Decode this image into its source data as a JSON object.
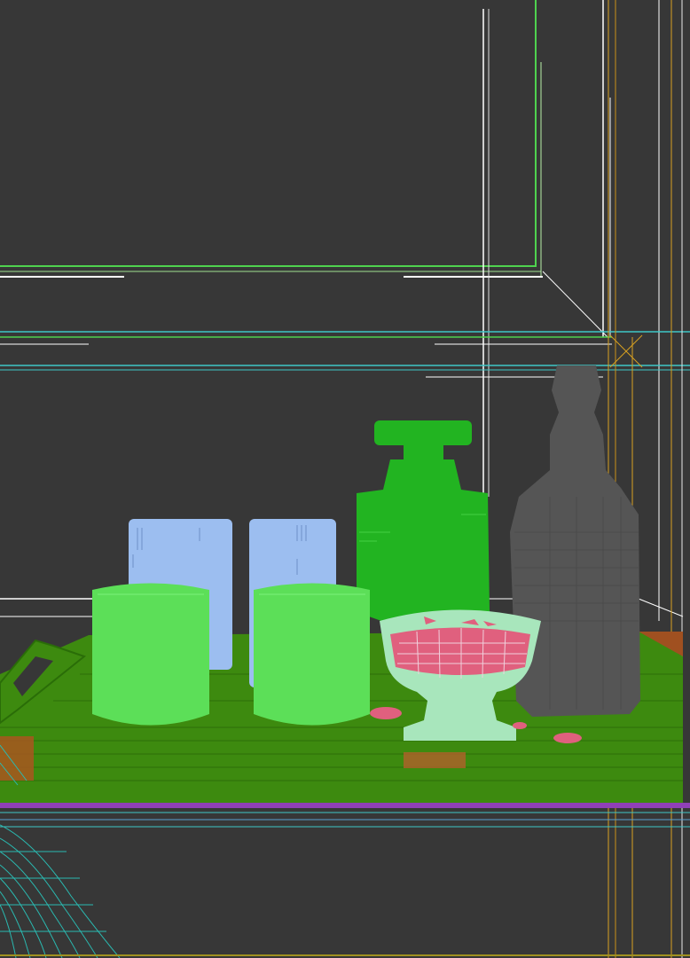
{
  "viewport": {
    "render_mode": "wireframe-shaded",
    "background": "#373737",
    "objects": [
      {
        "name": "wall-frame-molding",
        "color": "#4fd24f"
      },
      {
        "name": "wall-frame-inner-lines",
        "color": "#ffffff"
      },
      {
        "name": "shelf-rail",
        "color": "#3fc7c7"
      },
      {
        "name": "cabinet-edge-verticals",
        "color": "#d8a020"
      },
      {
        "name": "tray",
        "color": "#3d8a0f"
      },
      {
        "name": "tray-handle",
        "color": "#3d8a0f"
      },
      {
        "name": "blue-glass-left",
        "color": "#9cbef0"
      },
      {
        "name": "blue-glass-right",
        "color": "#9cbef0"
      },
      {
        "name": "green-glass-left",
        "color": "#5cdf58"
      },
      {
        "name": "green-glass-right",
        "color": "#5cdf58"
      },
      {
        "name": "decanter",
        "color": "#22b421"
      },
      {
        "name": "whisky-bottle",
        "color": "#555555"
      },
      {
        "name": "bowl",
        "color": "#a8e6bc"
      },
      {
        "name": "bowl-contents",
        "color": "#e0607e"
      },
      {
        "name": "chair-wireframe",
        "color": "#2ab9b0"
      },
      {
        "name": "table-edge",
        "color": "#9040b8"
      }
    ]
  }
}
